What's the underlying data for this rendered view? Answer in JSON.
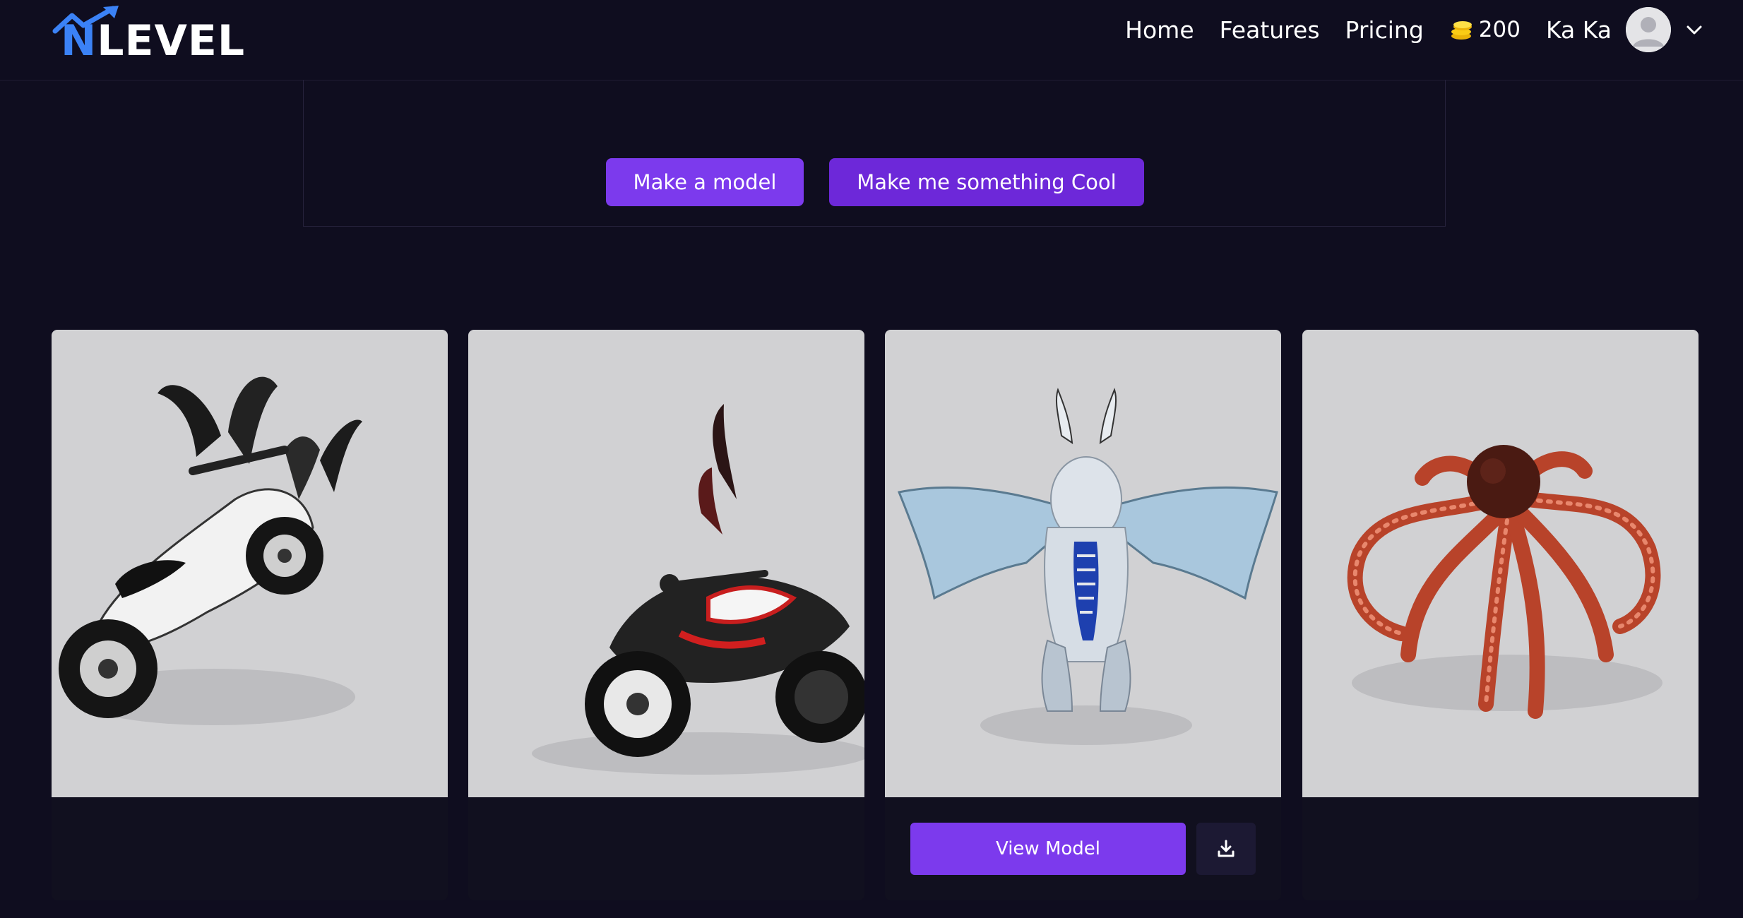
{
  "header": {
    "logo_text_n": "N",
    "logo_text_rest": "LEVEL",
    "nav": {
      "home": "Home",
      "features": "Features",
      "pricing": "Pricing"
    },
    "credits": "200",
    "user_name": "Ka Ka"
  },
  "prompt": {
    "make_model_label": "Make a model",
    "make_cool_label": "Make me something Cool"
  },
  "gallery": {
    "cards": [
      {
        "subject": "white motorcycle with black wings"
      },
      {
        "subject": "red and white motorcycle with dark wings"
      },
      {
        "subject": "white and blue dragon"
      },
      {
        "subject": "red octopus"
      }
    ],
    "view_model_label": "View Model"
  },
  "colors": {
    "background": "#0f0d1f",
    "accent": "#7c3aed",
    "accent_dark": "#6d28d9",
    "card_bg": "#d1d1d3",
    "logo_blue": "#3b82f6"
  }
}
